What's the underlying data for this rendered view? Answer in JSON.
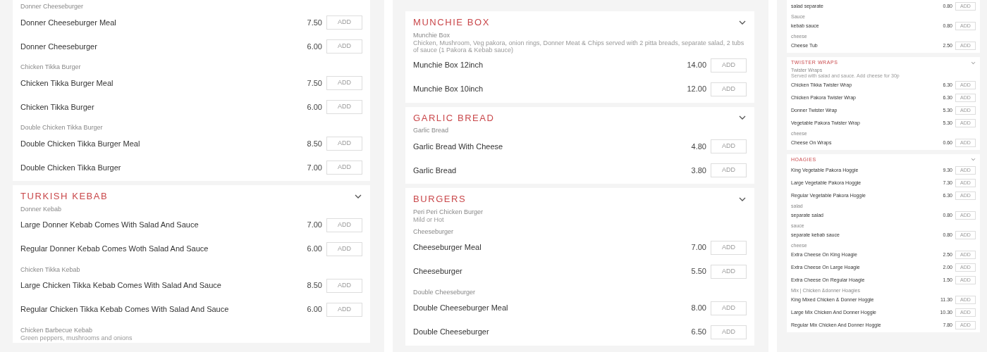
{
  "columns": [
    {
      "kind": "regular",
      "sections": [
        {
          "groups": [
            {
              "label": "Donner Cheeseburger",
              "items": [
                {
                  "name": "Donner Cheeseburger Meal",
                  "price": "7.50",
                  "button": "ADD"
                },
                {
                  "name": "Donner Cheeseburger",
                  "price": "6.00",
                  "button": "ADD"
                }
              ]
            },
            {
              "label": "Chicken Tikka Burger",
              "items": [
                {
                  "name": "Chicken Tikka Burger Meal",
                  "price": "7.50",
                  "button": "ADD"
                },
                {
                  "name": "Chicken Tikka Burger",
                  "price": "6.00",
                  "button": "ADD"
                }
              ]
            },
            {
              "label": "Double Chicken Tikka Burger",
              "items": [
                {
                  "name": "Double Chicken Tikka Burger Meal",
                  "price": "8.50",
                  "button": "ADD"
                },
                {
                  "name": "Double Chicken Tikka Burger",
                  "price": "7.00",
                  "button": "ADD"
                }
              ]
            }
          ]
        },
        {
          "title": "TURKISH KEBAB",
          "groups": [
            {
              "label": "Donner Kebab",
              "items": [
                {
                  "name": "Large Donner Kebab Comes With Salad And Sauce",
                  "price": "7.00",
                  "button": "ADD"
                },
                {
                  "name": "Regular Donner Kebab Comes Woth Salad And Sauce",
                  "price": "6.00",
                  "button": "ADD"
                }
              ]
            },
            {
              "label": "Chicken Tikka Kebab",
              "items": [
                {
                  "name": "Large Chicken Tikka Kebab Comes With Salad And Sauce",
                  "price": "8.50",
                  "button": "ADD"
                },
                {
                  "name": "Regular Chicken Tikka Kebab Comes With Salad And Sauce",
                  "price": "6.00",
                  "button": "ADD"
                }
              ]
            },
            {
              "label": "Chicken Barbecue Kebab",
              "description": "Green peppers, mushrooms and onions"
            }
          ]
        }
      ]
    },
    {
      "kind": "regular",
      "sections": [
        {
          "title": "MUNCHIE BOX",
          "groups": [
            {
              "label": "Munchie Box",
              "description": "Chicken, Mushroom, Veg pakora, onion rings, Donner Meat & Chips served with 2 pitta breads, separate salad, 2 tubs of sauce (1 Pakora & Kebab sauce)",
              "items": [
                {
                  "name": "Munchie Box 12inch",
                  "price": "14.00",
                  "button": "ADD"
                },
                {
                  "name": "Munchie Box 10inch",
                  "price": "12.00",
                  "button": "ADD"
                }
              ]
            }
          ]
        },
        {
          "title": "GARLIC BREAD",
          "groups": [
            {
              "label": "Garlic Bread",
              "items": [
                {
                  "name": "Garlic Bread With Cheese",
                  "price": "4.80",
                  "button": "ADD"
                },
                {
                  "name": "Garlic Bread",
                  "price": "3.80",
                  "button": "ADD"
                }
              ]
            }
          ]
        },
        {
          "title": "BURGERS",
          "groups": [
            {
              "label": "Peri Peri Chicken Burger",
              "description": "Mild or Hot"
            },
            {
              "label": "Cheeseburger",
              "items": [
                {
                  "name": "Cheeseburger Meal",
                  "price": "7.00",
                  "button": "ADD"
                },
                {
                  "name": "Cheeseburger",
                  "price": "5.50",
                  "button": "ADD"
                }
              ]
            },
            {
              "label": "Double Cheeseburger",
              "items": [
                {
                  "name": "Double Cheeseburger Meal",
                  "price": "8.00",
                  "button": "ADD"
                },
                {
                  "name": "Double Cheeseburger",
                  "price": "6.50",
                  "button": "ADD"
                }
              ]
            }
          ]
        }
      ]
    },
    {
      "kind": "compact",
      "sections": [
        {
          "groups": [
            {
              "items": [
                {
                  "name": "salad separate",
                  "price": "0.80",
                  "button": "ADD"
                }
              ]
            },
            {
              "label": "Sauce",
              "items": [
                {
                  "name": "kebab sauce",
                  "price": "0.80",
                  "button": "ADD"
                }
              ]
            },
            {
              "label": "cheese",
              "items": [
                {
                  "name": "Cheese Tub",
                  "price": "2.50",
                  "button": "ADD"
                }
              ]
            }
          ]
        },
        {
          "title": "TWISTER WRAPS",
          "groups": [
            {
              "label": "Twister Wraps",
              "description": "Served with salad and sauce. Add cheese for 30p",
              "items": [
                {
                  "name": "Chicken Tikka Twister Wrap",
                  "price": "6.30",
                  "button": "ADD"
                },
                {
                  "name": "Chicken Pakora Twister Wrap",
                  "price": "6.30",
                  "button": "ADD"
                },
                {
                  "name": "Donner Twister Wrap",
                  "price": "5.30",
                  "button": "ADD"
                },
                {
                  "name": "Vegetable Pakora Twister Wrap",
                  "price": "5.30",
                  "button": "ADD"
                }
              ]
            },
            {
              "label": "cheese",
              "items": [
                {
                  "name": "Cheese On Wraps",
                  "price": "0.60",
                  "button": "ADD"
                }
              ]
            }
          ]
        },
        {
          "title": "HOAGIES",
          "groups": [
            {
              "items": [
                {
                  "name": "King Vegetable Pakora Hoggie",
                  "price": "9.30",
                  "button": "ADD"
                },
                {
                  "name": "Large Vegetable Pakora Hoggie",
                  "price": "7.30",
                  "button": "ADD"
                },
                {
                  "name": "Regular Vegetable Pakora Hoggie",
                  "price": "6.30",
                  "button": "ADD"
                }
              ]
            },
            {
              "label": "salad",
              "items": [
                {
                  "name": "separate salad",
                  "price": "0.80",
                  "button": "ADD"
                }
              ]
            },
            {
              "label": "sauce",
              "items": [
                {
                  "name": "separate kebab sauce",
                  "price": "0.80",
                  "button": "ADD"
                }
              ]
            },
            {
              "label": "cheese",
              "items": [
                {
                  "name": "Extra Cheese On King Hoagie",
                  "price": "2.50",
                  "button": "ADD"
                },
                {
                  "name": "Extra Cheese On Large Hoagie",
                  "price": "2.00",
                  "button": "ADD"
                },
                {
                  "name": "Extra Cheese On Regular Hoagie",
                  "price": "1.50",
                  "button": "ADD"
                }
              ]
            },
            {
              "label": "Mix | Chicken &donner Hoagies",
              "items": [
                {
                  "name": "King Mixed Chicken & Donner Hoggie",
                  "price": "11.30",
                  "button": "ADD"
                },
                {
                  "name": "Large Mix Chicken And Donner Hoggie",
                  "price": "10.30",
                  "button": "ADD"
                },
                {
                  "name": "Regular Mix Chicken And Donner Hoggie",
                  "price": "7.80",
                  "button": "ADD"
                }
              ]
            }
          ]
        }
      ]
    }
  ]
}
